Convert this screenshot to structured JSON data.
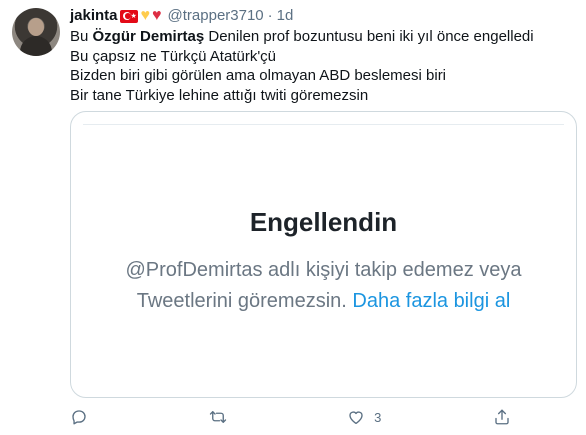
{
  "tweet": {
    "display_name": "jakinta",
    "handle": "@trapper3710",
    "separator": "·",
    "time": "1d",
    "text_lines": {
      "line1_prefix": "Bu ",
      "line1_mention": "Özgür Demirtaş",
      "line1_suffix": " Denilen prof bozuntusu  beni iki yıl önce engelledi",
      "line2": "Bu çapsız ne Türkçü Atatürk'çü",
      "line3": "Bizden biri gibi görülen ama olmayan ABD beslemesi biri",
      "line4": "Bir tane Türkiye lehine attığı twiti göremezsin"
    }
  },
  "quoted_image": {
    "title": "Engellendin",
    "line1": "@ProfDemirtas adlı kişiyi takip edemez veya",
    "line2_text": "Tweetlerini göremezsin. ",
    "line2_link": "Daha fazla bilgi al"
  },
  "actions": {
    "reply_count": "",
    "retweet_count": "",
    "like_count": "3",
    "share_count": ""
  },
  "icons": [
    "reply-icon",
    "retweet-icon",
    "like-icon",
    "share-icon",
    "turkey-flag-icon",
    "yellow-heart-icon",
    "red-heart-icon"
  ],
  "colors": {
    "text": "#0f1419",
    "secondary": "#5b7083",
    "link": "#1b95e0",
    "border": "#cfd9de",
    "flag_red": "#e30a17",
    "heart_yellow": "#ffcc4d",
    "heart_red": "#dd2e44"
  }
}
